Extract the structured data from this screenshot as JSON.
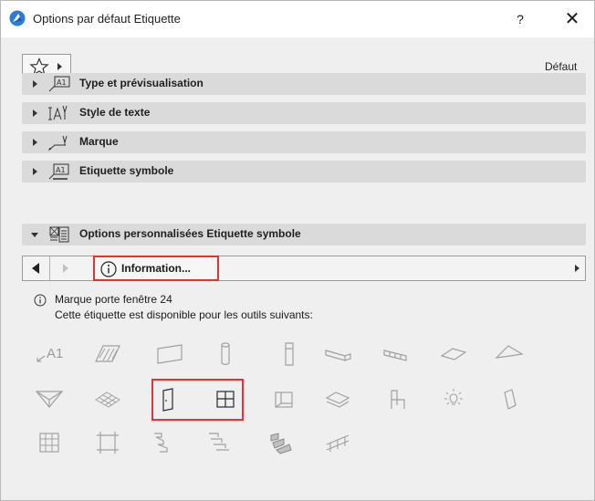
{
  "window": {
    "title": "Options par défaut Etiquette",
    "help_label": "?",
    "close_label": "✕",
    "logo_icon": "archicad-logo-icon"
  },
  "toolbar": {
    "favorites_icon": "star-icon",
    "default_label": "Défaut"
  },
  "panels": [
    {
      "label": "Type et prévisualisation",
      "icon": "label-preview-icon",
      "expanded": false
    },
    {
      "label": "Style de texte",
      "icon": "text-style-icon",
      "expanded": false
    },
    {
      "label": "Marque",
      "icon": "pointer-icon",
      "expanded": false
    },
    {
      "label": "Etiquette symbole",
      "icon": "symbol-label-icon",
      "expanded": false
    },
    {
      "label": "Options personnalisées Etiquette symbole",
      "icon": "custom-settings-icon",
      "expanded": true
    }
  ],
  "custom_panel": {
    "page_dropdown_value": "Information...",
    "info_title": "Marque porte fenêtre 24",
    "info_description": "Cette étiquette est disponible pour les outils suivants:"
  },
  "tools": {
    "text_label_icon_text": "A1",
    "row1": [
      "label-tool-icon",
      "fill-tool-icon",
      "slab-tool-icon",
      "column-tool-icon",
      "beam-tool-icon",
      "wall-tool-icon",
      "curtain-wall-tool-icon",
      "roof-tool-icon",
      "shell-tool-icon"
    ],
    "row2": [
      "mesh-tool-icon",
      "morph-tool-icon",
      "door-tool-icon",
      "window-tool-icon",
      "skylight-tool-icon",
      "zone-tool-icon",
      "object-tool-icon",
      "lamp-tool-icon",
      "corner-window-icon"
    ],
    "row3": [
      "curtain-wall-panel-icon",
      "frame-icon",
      "stair-icon",
      "stair-flight-icon",
      "stair-landing-icon",
      "railing-icon"
    ],
    "highlighted": [
      "door-tool-icon",
      "window-tool-icon"
    ]
  },
  "colors": {
    "highlight": "#e8322d",
    "panel_bg": "#dadada",
    "window_bg": "#efefef",
    "tool_icon": "#a0a0a0"
  }
}
